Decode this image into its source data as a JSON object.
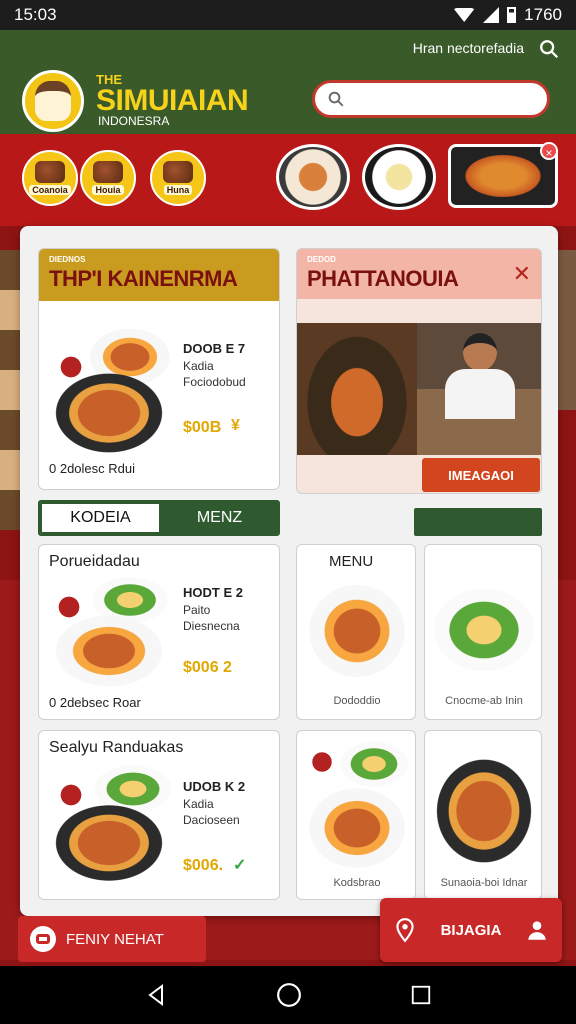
{
  "status_bar": {
    "time": "15:03",
    "battery": "1760"
  },
  "header": {
    "tagline": "Hran nectorefadia",
    "brand_the": "THE",
    "brand_name": "SIMUIAIAN",
    "brand_sub": "INDONESRA",
    "search_placeholder": ""
  },
  "categories": [
    {
      "label": "Coanoia",
      "icon": "drink-icon"
    },
    {
      "label": "Houia",
      "icon": "satay-icon"
    },
    {
      "label": "Huna",
      "icon": "grill-icon"
    }
  ],
  "featured": [
    {
      "tag": "DIEDNOS",
      "title": "THP'I KAINENRMA",
      "code": "DOOB E 7",
      "line1": "Kadia",
      "line2": "Fociodobud",
      "price": "$00B",
      "check": "¥",
      "footer": "0 2dolesc Rdui"
    },
    {
      "tag": "DEDOD",
      "title": "PHATTANOUIA",
      "cta": "IMEAGAOI"
    }
  ],
  "toggle": {
    "left": "KODEIA",
    "right": "MENZ"
  },
  "menu_items": [
    {
      "title": "Porueidadau",
      "code": "HODT E 2",
      "line1": "Paito",
      "line2": "Diesnecna",
      "price": "$006 2",
      "footer": "0 2debsec Roar"
    },
    {
      "title": "Sealyu Randuakas",
      "code": "UDOB K 2",
      "line1": "Kadia",
      "line2": "Dacioseen",
      "price": "$006.",
      "check": "✓"
    }
  ],
  "grid_cards": [
    {
      "title": "MENU",
      "footer": "Dododdio"
    },
    {
      "title": "",
      "footer": "Cnocme-ab Inin"
    },
    {
      "title": "",
      "footer": "Kodsbrao"
    },
    {
      "title": "",
      "footer": "Sunaoia-boi Idnar"
    }
  ],
  "bottom": {
    "pill_label": "FENIY NEHAT",
    "fab_label": "BIJAGIA"
  },
  "colors": {
    "brand_green": "#3b5a2a",
    "brand_red": "#b81818",
    "accent_yellow": "#f7d21b"
  }
}
